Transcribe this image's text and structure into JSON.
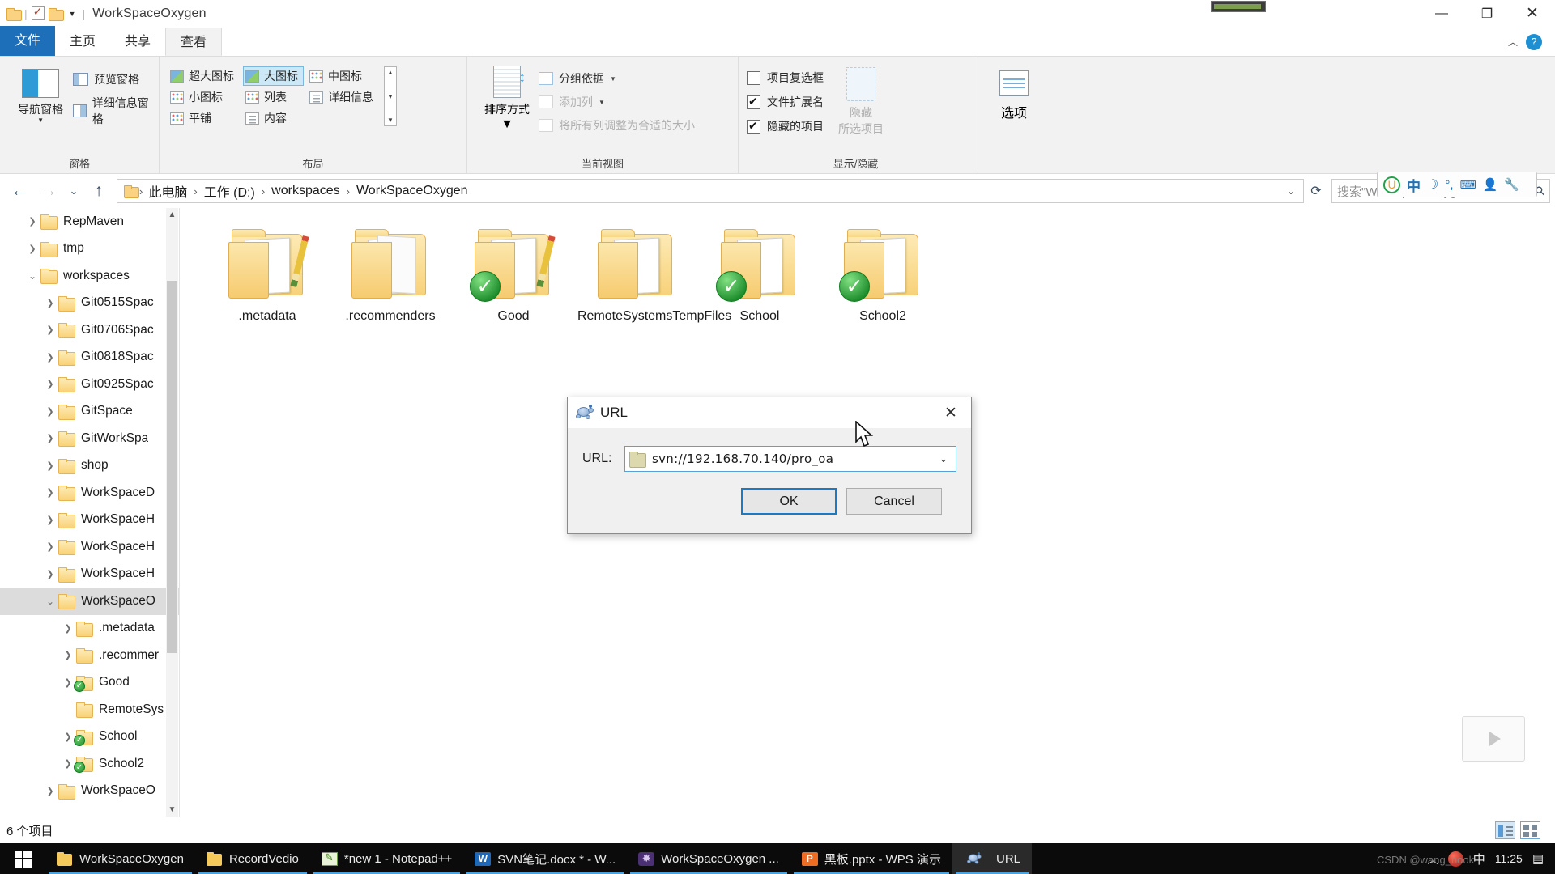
{
  "window": {
    "title": "WorkSpaceOxygen",
    "minimize": "—",
    "maximize": "❐",
    "close": "✕"
  },
  "tabs": [
    {
      "label": "文件",
      "name": "tab-file"
    },
    {
      "label": "主页",
      "name": "tab-home"
    },
    {
      "label": "共享",
      "name": "tab-share"
    },
    {
      "label": "查看",
      "name": "tab-view"
    }
  ],
  "ribbon": {
    "panes": {
      "group_title": "窗格",
      "nav_pane": "导航窗格",
      "preview_pane": "预览窗格",
      "details_pane": "详细信息窗格"
    },
    "layout": {
      "group_title": "布局",
      "items": [
        "超大图标",
        "大图标",
        "中图标",
        "小图标",
        "列表",
        "详细信息",
        "平铺",
        "内容"
      ],
      "selected": "大图标"
    },
    "current_view": {
      "group_title": "当前视图",
      "sort_by": "排序方式",
      "group_by": "分组依据",
      "add_column": "添加列",
      "size_columns": "将所有列调整为合适的大小"
    },
    "show_hide": {
      "group_title": "显示/隐藏",
      "item_checkboxes": {
        "label": "项目复选框",
        "checked": false
      },
      "file_extensions": {
        "label": "文件扩展名",
        "checked": true
      },
      "hidden_items": {
        "label": "隐藏的项目",
        "checked": true
      },
      "hide_line1": "隐藏",
      "hide_line2": "所选项目"
    },
    "options": {
      "label": "选项"
    }
  },
  "address": {
    "back": "←",
    "forward": "→",
    "recent": "⌄",
    "up": "↑",
    "crumbs": [
      "此电脑",
      "工作 (D:)",
      "workspaces",
      "WorkSpaceOxygen"
    ],
    "dropdown": "⌄",
    "refresh": "⟳"
  },
  "search": {
    "placeholder": "搜索\"WorkSpaceOxygen\"",
    "icon": "search-icon"
  },
  "ime_toolbar": {
    "power": "U",
    "lang": "中",
    "moon": "☽",
    "degree": "°,",
    "keyboard": "⌨",
    "person": "👤",
    "wrench": "🔧"
  },
  "nav_tree": [
    {
      "label": "RepMaven",
      "indent": 1,
      "expander": "collapsed",
      "overlay": false,
      "selected": false
    },
    {
      "label": "tmp",
      "indent": 1,
      "expander": "collapsed",
      "overlay": false,
      "selected": false
    },
    {
      "label": "workspaces",
      "indent": 1,
      "expander": "expanded",
      "overlay": false,
      "selected": false
    },
    {
      "label": "Git0515Spac",
      "indent": 2,
      "expander": "collapsed",
      "overlay": false,
      "selected": false
    },
    {
      "label": "Git0706Spac",
      "indent": 2,
      "expander": "collapsed",
      "overlay": false,
      "selected": false
    },
    {
      "label": "Git0818Spac",
      "indent": 2,
      "expander": "collapsed",
      "overlay": false,
      "selected": false
    },
    {
      "label": "Git0925Spac",
      "indent": 2,
      "expander": "collapsed",
      "overlay": false,
      "selected": false
    },
    {
      "label": "GitSpace",
      "indent": 2,
      "expander": "collapsed",
      "overlay": false,
      "selected": false
    },
    {
      "label": "GitWorkSpa",
      "indent": 2,
      "expander": "collapsed",
      "overlay": false,
      "selected": false
    },
    {
      "label": "shop",
      "indent": 2,
      "expander": "collapsed",
      "overlay": false,
      "selected": false
    },
    {
      "label": "WorkSpaceD",
      "indent": 2,
      "expander": "collapsed",
      "overlay": false,
      "selected": false
    },
    {
      "label": "WorkSpaceH",
      "indent": 2,
      "expander": "collapsed",
      "overlay": false,
      "selected": false
    },
    {
      "label": "WorkSpaceH",
      "indent": 2,
      "expander": "collapsed",
      "overlay": false,
      "selected": false
    },
    {
      "label": "WorkSpaceH",
      "indent": 2,
      "expander": "collapsed",
      "overlay": false,
      "selected": false
    },
    {
      "label": "WorkSpaceO",
      "indent": 2,
      "expander": "expanded",
      "overlay": false,
      "selected": true
    },
    {
      "label": ".metadata",
      "indent": 3,
      "expander": "collapsed",
      "overlay": false,
      "selected": false
    },
    {
      "label": ".recommer",
      "indent": 3,
      "expander": "collapsed",
      "overlay": false,
      "selected": false
    },
    {
      "label": "Good",
      "indent": 3,
      "expander": "collapsed",
      "overlay": true,
      "selected": false
    },
    {
      "label": "RemoteSys",
      "indent": 3,
      "expander": "none",
      "overlay": false,
      "selected": false
    },
    {
      "label": "School",
      "indent": 3,
      "expander": "collapsed",
      "overlay": true,
      "selected": false
    },
    {
      "label": "School2",
      "indent": 3,
      "expander": "collapsed",
      "overlay": true,
      "selected": false
    },
    {
      "label": "WorkSpaceO",
      "indent": 2,
      "expander": "collapsed",
      "overlay": false,
      "selected": false
    }
  ],
  "files": [
    {
      "name": ".metadata",
      "style": "pencil",
      "overlay": false
    },
    {
      "name": ".recommenders",
      "style": "docs",
      "overlay": false
    },
    {
      "name": "Good",
      "style": "pencil",
      "overlay": true
    },
    {
      "name": "RemoteSystemsTempFiles",
      "style": "plain",
      "overlay": false
    },
    {
      "name": "School",
      "style": "plain",
      "overlay": true
    },
    {
      "name": "School2",
      "style": "plain",
      "overlay": true
    }
  ],
  "status": {
    "item_count": "6 个项目"
  },
  "dialog": {
    "title": "URL",
    "icon": "tortoisesvn-turtle-icon",
    "close": "✕",
    "url_label": "URL:",
    "url_value": "svn://192.168.70.140/pro_oa",
    "dropdown_arrow": "⌄",
    "ok": "OK",
    "cancel": "Cancel"
  },
  "taskbar": {
    "start": "start-button",
    "items": [
      {
        "label": "WorkSpaceOxygen",
        "icon": "folder",
        "active": false
      },
      {
        "label": "RecordVedio",
        "icon": "folder",
        "active": false
      },
      {
        "label": "*new 1 - Notepad++",
        "icon": "npp",
        "active": false
      },
      {
        "label": "SVN笔记.docx * - W...",
        "icon": "word",
        "active": false
      },
      {
        "label": "WorkSpaceOxygen ...",
        "icon": "eclipse",
        "active": false
      },
      {
        "label": "黑板.pptx - WPS 演示",
        "icon": "wps",
        "active": false
      },
      {
        "label": "URL",
        "icon": "turtle",
        "active": true
      }
    ],
    "tray": {
      "chevron": "︿",
      "security": "security-shield-icon",
      "ime": "中",
      "time": "11:25",
      "notifications": "▤"
    }
  },
  "watermark": "CSDN @wang_nook",
  "colors": {
    "accent_blue": "#1e6fba",
    "tab_file": "#1e6fba",
    "selected_row": "#dcdcdc",
    "folder_yellow": "#f8d27a",
    "overlay_green": "#1d8d2c",
    "taskbar": "#0b0b0b",
    "dialog_bg": "#f0f0f0"
  }
}
